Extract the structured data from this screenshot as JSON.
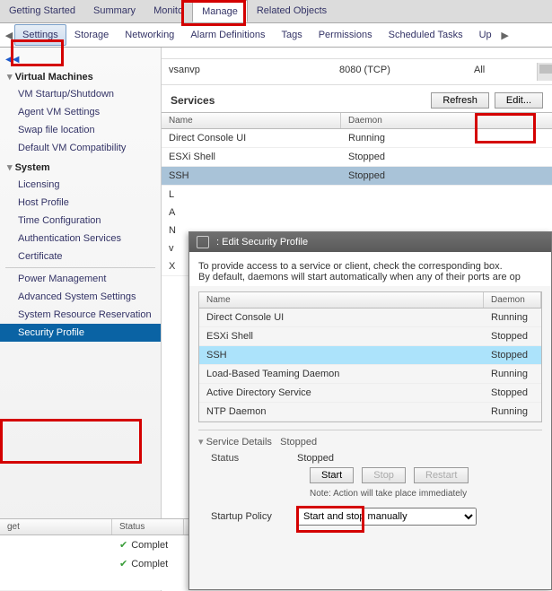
{
  "top_tabs": {
    "t0": "Getting Started",
    "t1": "Summary",
    "t2": "Monito",
    "t3": "Manage",
    "t4": "Related Objects"
  },
  "sub_tabs": {
    "t0": "Settings",
    "t1": "Storage",
    "t2": "Networking",
    "t3": "Alarm Definitions",
    "t4": "Tags",
    "t5": "Permissions",
    "t6": "Scheduled Tasks",
    "t7": "Up"
  },
  "sidebar": {
    "g0": "Virtual Machines",
    "g0i0": "VM Startup/Shutdown",
    "g0i1": "Agent VM Settings",
    "g0i2": "Swap file location",
    "g0i3": "Default VM Compatibility",
    "g1": "System",
    "g1i0": "Licensing",
    "g1i1": "Host Profile",
    "g1i2": "Time Configuration",
    "g1i3": "Authentication Services",
    "g1i4": "Certificate",
    "g1i5": "Power Management",
    "g1i6": "Advanced System Settings",
    "g1i7": "System Resource Reservation",
    "g1i8": "Security Profile"
  },
  "firewall": {
    "name": "vsanvp",
    "port": "8080 (TCP)",
    "ip": "All"
  },
  "services": {
    "title": "Services",
    "refresh": "Refresh",
    "edit": "Edit...",
    "hdr_name": "Name",
    "hdr_daemon": "Daemon",
    "r0n": "Direct Console UI",
    "r0d": "Running",
    "r1n": "ESXi Shell",
    "r1d": "Stopped",
    "r2n": "SSH",
    "r2d": "Stopped",
    "stub0": "L",
    "stub1": "A",
    "stub2": "N",
    "stub3": "v",
    "stub4": "X"
  },
  "tasks": {
    "h0": "get",
    "h1": "Status",
    "s0": "Complet",
    "s1": "Complet"
  },
  "modal": {
    "title": ": Edit Security Profile",
    "desc1": "To provide access to a service or client, check the corresponding box.",
    "desc2": "By default, daemons will start automatically when any of their ports are op",
    "hdr_name": "Name",
    "hdr_daemon": "Daemon",
    "r0n": "Direct Console UI",
    "r0d": "Running",
    "r1n": "ESXi Shell",
    "r1d": "Stopped",
    "r2n": "SSH",
    "r2d": "Stopped",
    "r3n": "Load-Based Teaming Daemon",
    "r3d": "Running",
    "r4n": "Active Directory Service",
    "r4d": "Stopped",
    "r5n": "NTP Daemon",
    "r5d": "Running",
    "sd_title": "Service Details",
    "sd_state": "Stopped",
    "status_k": "Status",
    "status_v": "Stopped",
    "btn_start": "Start",
    "btn_stop": "Stop",
    "btn_restart": "Restart",
    "note": "Note: Action will take place immediately",
    "policy_k": "Startup Policy",
    "policy_v": "Start and stop manually"
  }
}
